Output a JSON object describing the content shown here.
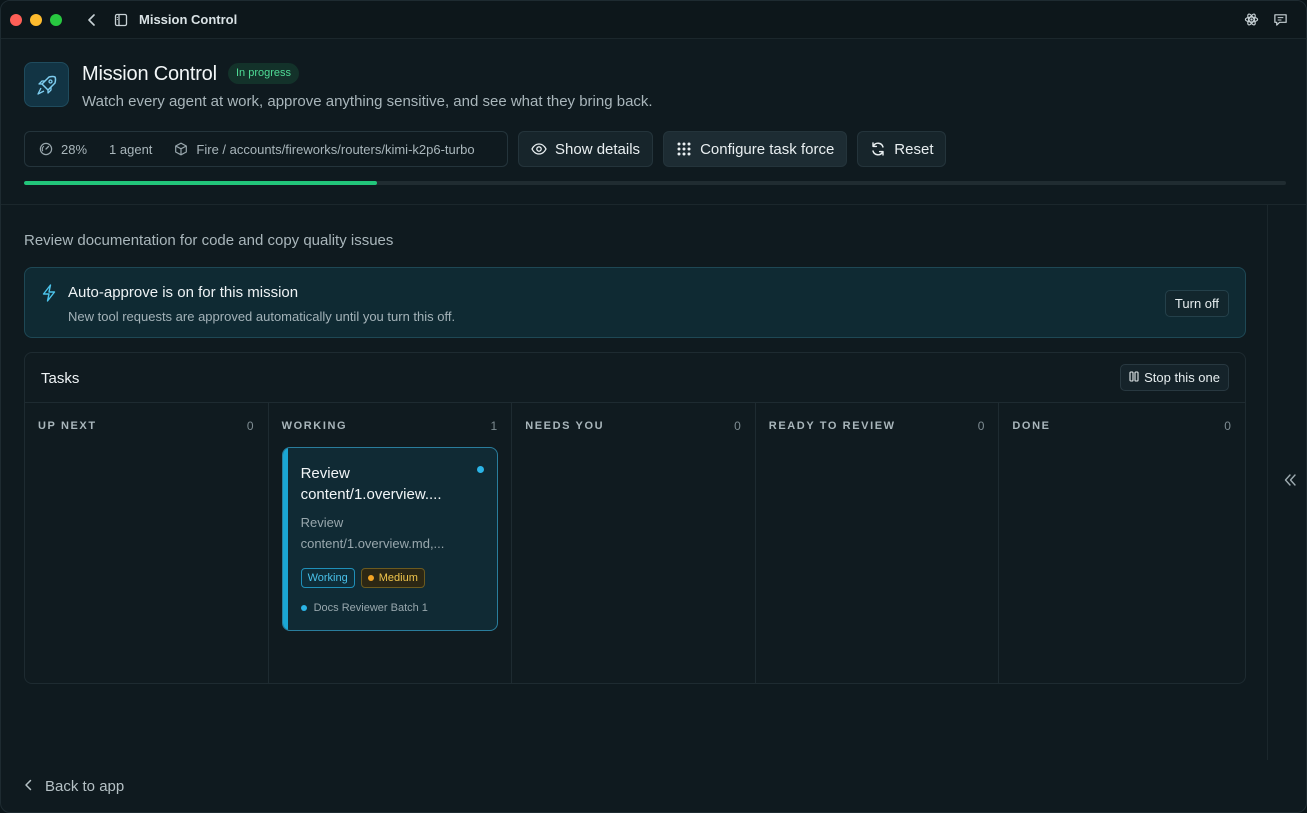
{
  "window": {
    "title": "Mission Control"
  },
  "header": {
    "title": "Mission Control",
    "status": "In progress",
    "subtitle": "Watch every agent at work, approve anything sensitive, and see what they bring back."
  },
  "toolbar": {
    "progress_label": "28%",
    "agents_label": "1 agent",
    "model_label": "Fire / accounts/fireworks/routers/kimi-k2p6-turbo",
    "show_details": "Show details",
    "configure": "Configure task force",
    "reset": "Reset"
  },
  "progress": {
    "percent": 28
  },
  "mission": {
    "description": "Review documentation for code and copy quality issues"
  },
  "banner": {
    "title": "Auto-approve is on for this mission",
    "subtitle": "New tool requests are approved automatically until you turn this off.",
    "action": "Turn off"
  },
  "tasks": {
    "title": "Tasks",
    "stop_label": "Stop this one",
    "columns": [
      {
        "label": "UP NEXT",
        "count": "0"
      },
      {
        "label": "WORKING",
        "count": "1"
      },
      {
        "label": "NEEDS YOU",
        "count": "0"
      },
      {
        "label": "READY TO REVIEW",
        "count": "0"
      },
      {
        "label": "DONE",
        "count": "0"
      }
    ],
    "card": {
      "title": "Review content/1.overview....",
      "description": "Review content/1.overview.md,...",
      "tag_status": "Working",
      "tag_priority": "Medium",
      "agent": "Docs Reviewer Batch 1"
    }
  },
  "footer": {
    "back_label": "Back to app"
  },
  "colors": {
    "accent": "#1aa6d4",
    "progress": "#22c57a",
    "status": "#4fdc96",
    "priority": "#f2a324"
  },
  "icons": [
    "back-chevron-icon",
    "sidebar-icon",
    "atom-icon",
    "chat-icon",
    "rocket-icon",
    "gauge-icon",
    "cube-icon",
    "eye-icon",
    "grid-icon",
    "refresh-icon",
    "bolt-icon",
    "pause-icon",
    "double-chevron-left-icon"
  ]
}
